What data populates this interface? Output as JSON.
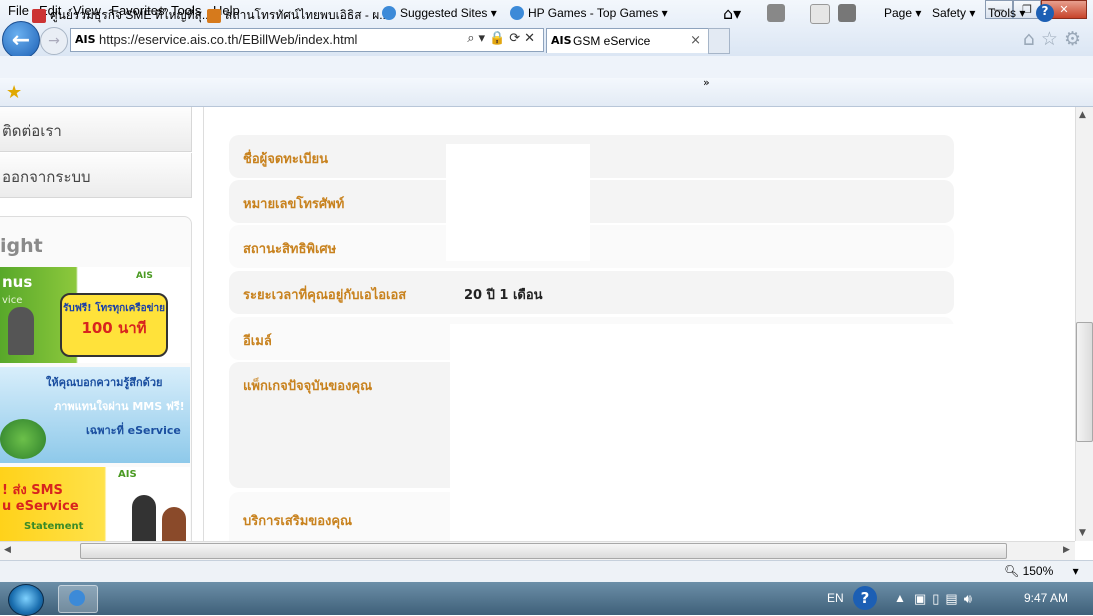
{
  "browser": {
    "window_buttons": {
      "minimize": "—",
      "restore": "❐",
      "close": "✕"
    },
    "address": {
      "site_logo": "AIS",
      "url": "https://eservice.ais.co.th/EBillWeb/index.html"
    },
    "tab": {
      "logo": "AIS",
      "title": "GSM eService"
    },
    "menu": [
      "File",
      "Edit",
      "View",
      "Favorites",
      "Tools",
      "Help"
    ],
    "favorites": [
      {
        "label": "ศูนย์รวมธุรกิจ SME ที่ใหญ่ที่สุ...",
        "icon": "page-icon"
      },
      {
        "label": "สถานโทรทัศน์ไทยพบเอิธิส - ผ...",
        "icon": "tv-icon"
      },
      {
        "label": "Suggested Sites ▾",
        "icon": "ie-icon"
      },
      {
        "label": "HP Games - Top Games ▾",
        "icon": "ie-icon"
      }
    ],
    "commands": {
      "page": "Page ▾",
      "safety": "Safety ▾",
      "tools": "Tools ▾"
    },
    "zoom": "150%"
  },
  "sidebar": {
    "links": [
      "ติดต่อเรา",
      "ออกจากระบบ"
    ],
    "highlight_title": "ight",
    "banners": [
      {
        "heading": "nus",
        "sub": "vice",
        "badge": "รับฟรี! โทรทุกเครือข่าย",
        "minutes": "100 นาที"
      },
      {
        "line1": "ให้คุณบอกความรู้สึกด้วย",
        "line2": "ภาพแทนใจผ่าน MMS ฟรี!",
        "line3": "เฉพาะที่ eService"
      },
      {
        "line1": "! ส่ง SMS",
        "line2": "u eService",
        "tag": "Statement",
        "logo": "AIS"
      }
    ]
  },
  "profile": {
    "rows": [
      {
        "label": "ชื่อผู้จดทะเบียน",
        "value": ""
      },
      {
        "label": "หมายเลขโทรศัพท์",
        "value": ""
      },
      {
        "label": "สถานะสิทธิพิเศษ",
        "value": ""
      },
      {
        "label": "ระยะเวลาที่คุณอยู่กับเอไอเอส",
        "value": "20 ปี 1 เดือน"
      },
      {
        "label": "อีเมล์",
        "value": ""
      },
      {
        "label": "แพ็กเกจปัจจุบันของคุณ",
        "value": ""
      },
      {
        "label": "บริการเสริมของคุณ",
        "value": ""
      }
    ]
  },
  "taskbar": {
    "language": "EN",
    "time": "9:47 AM"
  }
}
